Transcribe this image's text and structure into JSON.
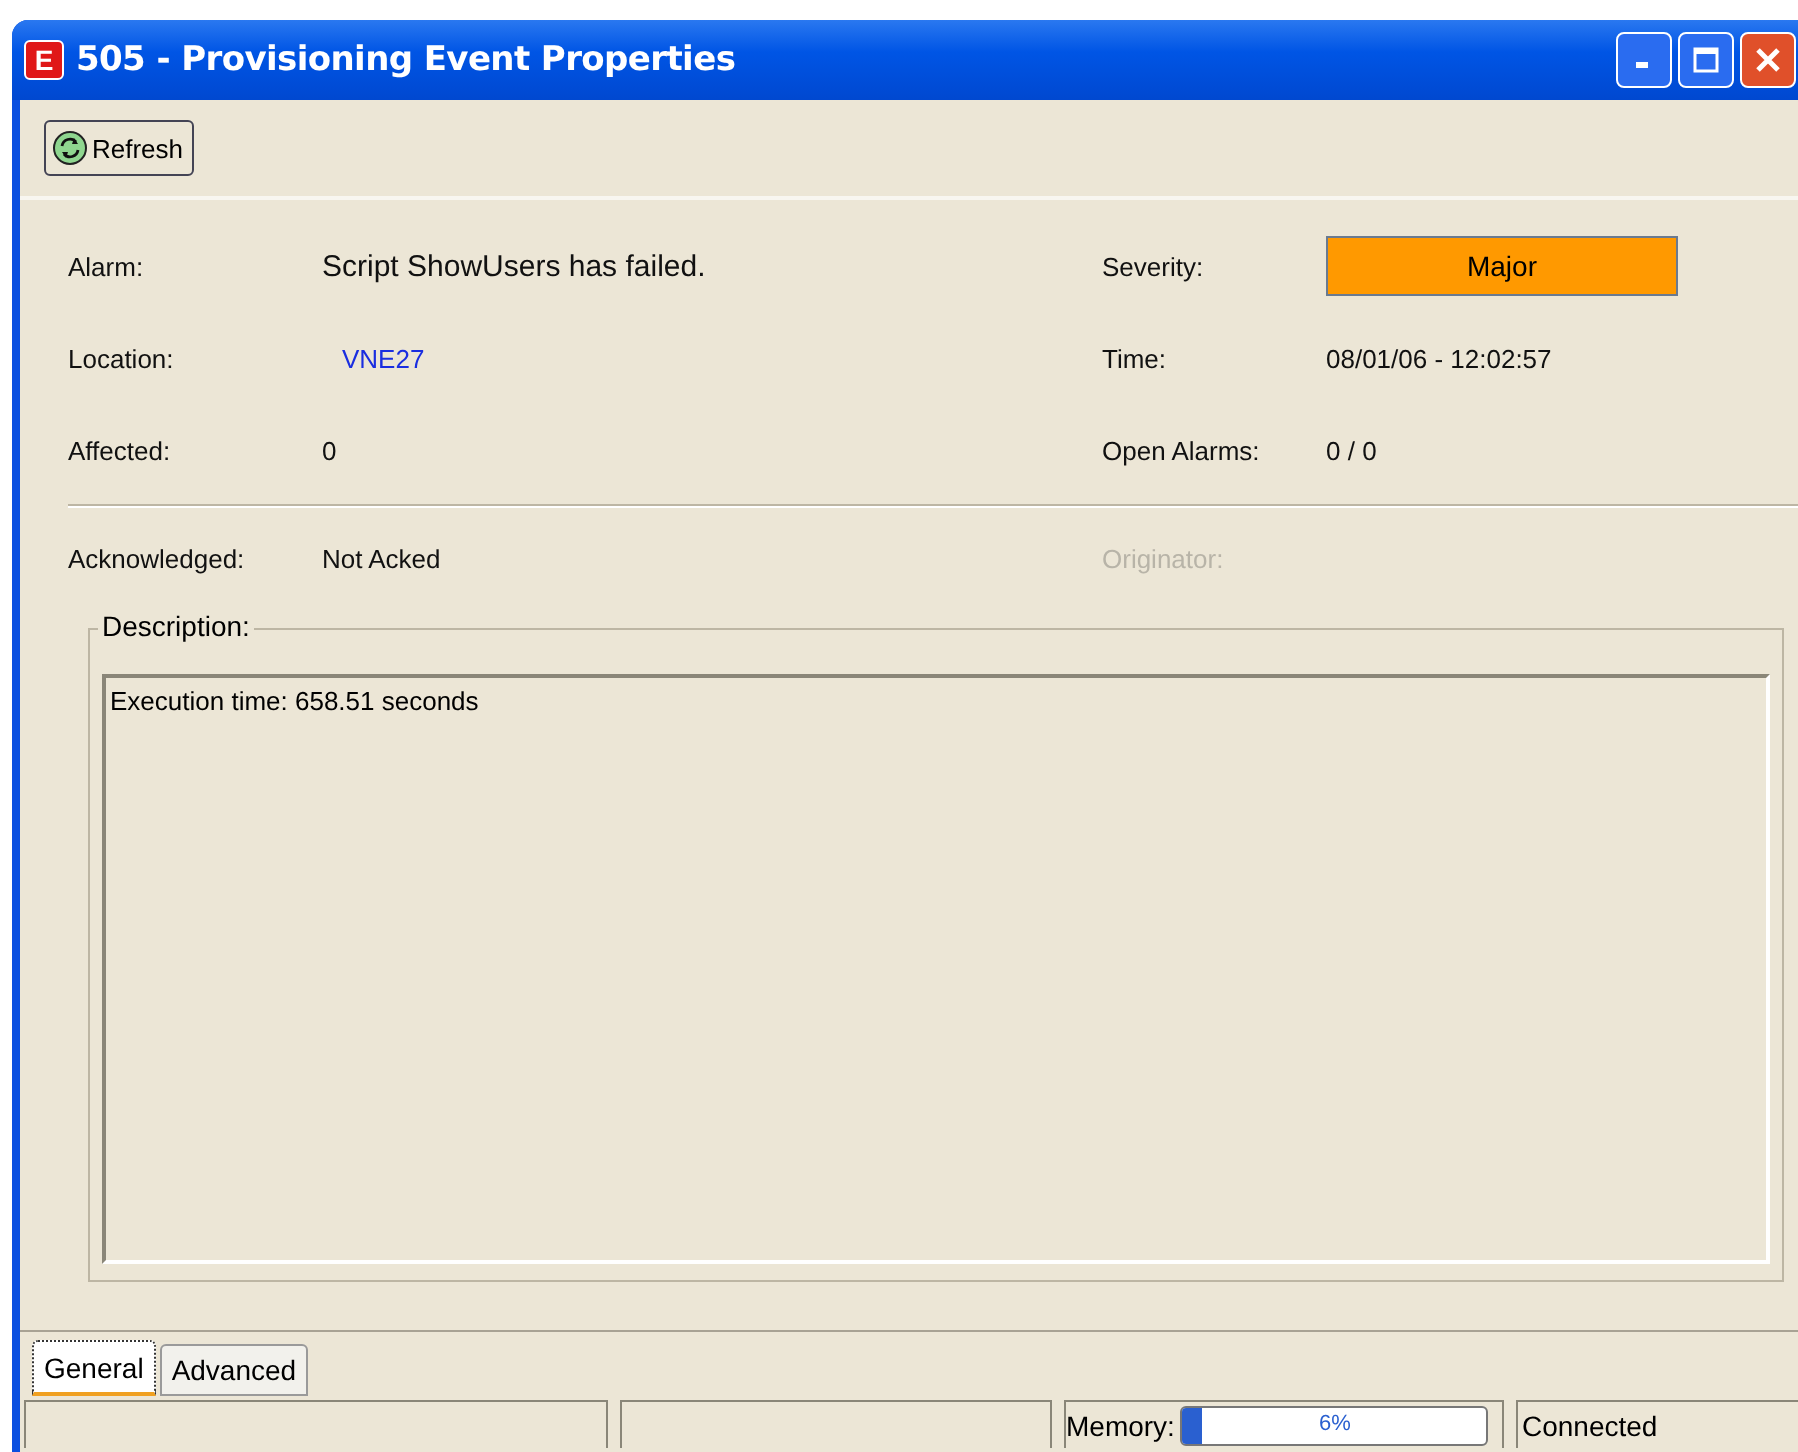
{
  "window": {
    "title": "505 - Provisioning Event Properties",
    "app_letter": "E"
  },
  "toolbar": {
    "refresh": "Refresh"
  },
  "fields_left": [
    {
      "label": "Alarm:",
      "value": "Script ShowUsers has failed.",
      "kind": "text"
    },
    {
      "label": "Location:",
      "value": "VNE27",
      "kind": "link"
    },
    {
      "label": "Affected:",
      "value": "0",
      "kind": "text"
    }
  ],
  "fields_right": [
    {
      "label": "Severity:",
      "value": "Major",
      "kind": "severity",
      "color": "#ff9900"
    },
    {
      "label": "Time:",
      "value": "08/01/06 - 12:02:57",
      "kind": "text"
    },
    {
      "label": "Open Alarms:",
      "value": "0  /  0",
      "kind": "text"
    }
  ],
  "acknowledged": {
    "label": "Acknowledged:",
    "value": "Not Acked"
  },
  "originator": {
    "label": "Originator:",
    "disabled": true
  },
  "description": {
    "legend": "Description:",
    "text": "Execution time: 658.51 seconds"
  },
  "tabs": [
    {
      "label": "General",
      "selected": true
    },
    {
      "label": "Advanced",
      "selected": false
    }
  ],
  "status_bar": {
    "memory_label": "Memory:",
    "memory_reading": "6%",
    "level": 0.06,
    "connection": "Connected"
  }
}
